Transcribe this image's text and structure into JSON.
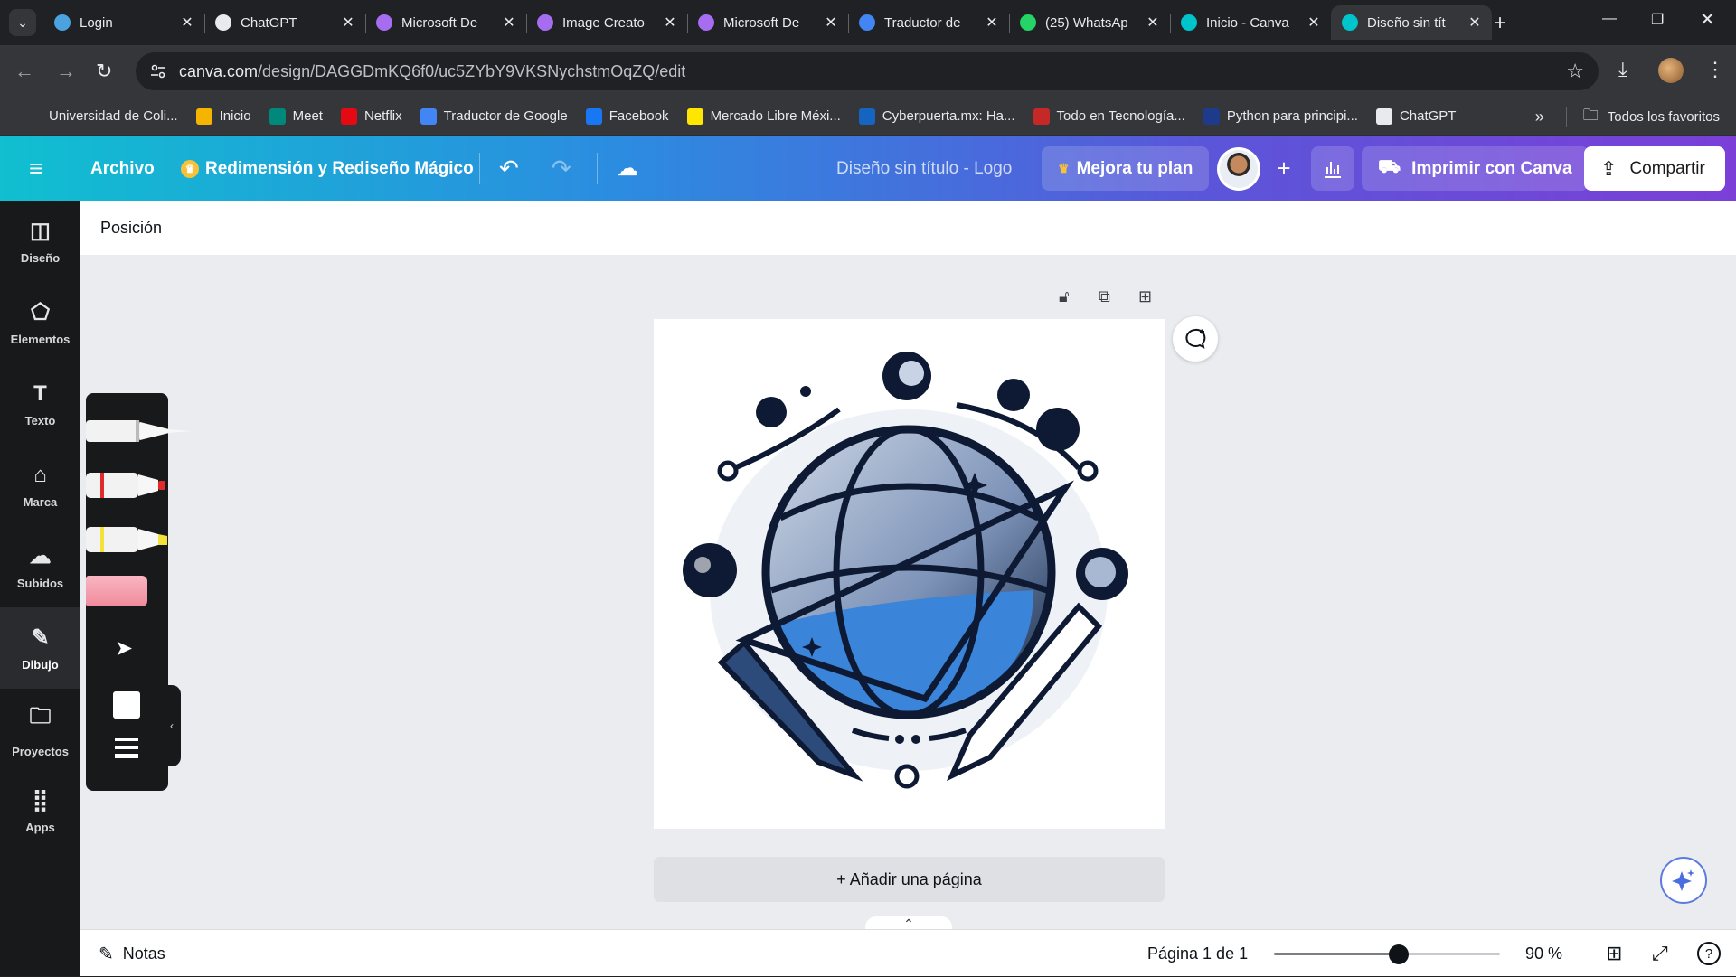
{
  "browser": {
    "tabs": [
      {
        "title": "Login",
        "icon": "login-icon",
        "color": "#4aa3df"
      },
      {
        "title": "ChatGPT",
        "icon": "chatgpt-icon",
        "color": "#e8eaed"
      },
      {
        "title": "Microsoft De",
        "icon": "microsoft-designer-icon",
        "color": "#a66df0"
      },
      {
        "title": "Image Creato",
        "icon": "image-creator-icon",
        "color": "#a66df0"
      },
      {
        "title": "Microsoft De",
        "icon": "microsoft-designer-icon",
        "color": "#a66df0"
      },
      {
        "title": "Traductor de",
        "icon": "google-translate-icon",
        "color": "#4285f4"
      },
      {
        "title": "(25) WhatsAp",
        "icon": "whatsapp-icon",
        "color": "#25d366"
      },
      {
        "title": "Inicio - Canva",
        "icon": "canva-icon",
        "color": "#00c4cc"
      },
      {
        "title": "Diseño sin tít",
        "icon": "canva-icon",
        "color": "#00c4cc",
        "active": true
      }
    ],
    "url_domain": "canva.com",
    "url_path": "/design/DAGGDmKQ6f0/uc5ZYbY9VKSNychstmOqZQ/edit",
    "bookmarks": [
      {
        "label": "Universidad de Coli...",
        "icon": "blank-icon",
        "color": "#35363a"
      },
      {
        "label": "Inicio",
        "icon": "classroom-icon",
        "color": "#f4b400"
      },
      {
        "label": "Meet",
        "icon": "meet-icon",
        "color": "#00897b"
      },
      {
        "label": "Netflix",
        "icon": "netflix-icon",
        "color": "#e50914"
      },
      {
        "label": "Traductor de Google",
        "icon": "google-translate-icon",
        "color": "#4285f4"
      },
      {
        "label": "Facebook",
        "icon": "facebook-icon",
        "color": "#1877f2"
      },
      {
        "label": "Mercado Libre Méxi...",
        "icon": "mercadolibre-icon",
        "color": "#ffe600"
      },
      {
        "label": "Cyberpuerta.mx: Ha...",
        "icon": "cyberpuerta-icon",
        "color": "#1565c0"
      },
      {
        "label": "Todo en Tecnología...",
        "icon": "todo-tecnologia-icon",
        "color": "#c62828"
      },
      {
        "label": "Python para principi...",
        "icon": "python-icon",
        "color": "#1e3a8a"
      },
      {
        "label": "ChatGPT",
        "icon": "chatgpt-icon",
        "color": "#e8eaed"
      }
    ],
    "all_bookmarks": "Todos los favoritos"
  },
  "header": {
    "file": "Archivo",
    "magic": "Redimensión y Rediseño Mágico",
    "design_title": "Diseño sin título - Logo",
    "upgrade": "Mejora tu plan",
    "print": "Imprimir con Canva",
    "share": "Compartir",
    "brand_gradient": [
      "#10bfd0",
      "#7b3fd8"
    ]
  },
  "rail": [
    {
      "label": "Diseño",
      "icon": "layout-icon"
    },
    {
      "label": "Elementos",
      "icon": "shapes-icon"
    },
    {
      "label": "Texto",
      "icon": "text-icon"
    },
    {
      "label": "Marca",
      "icon": "brand-icon"
    },
    {
      "label": "Subidos",
      "icon": "upload-cloud-icon"
    },
    {
      "label": "Dibujo",
      "icon": "draw-icon",
      "active": true
    },
    {
      "label": "Proyectos",
      "icon": "folder-icon"
    },
    {
      "label": "Apps",
      "icon": "apps-grid-icon"
    }
  ],
  "workspace": {
    "position": "Posición",
    "add_page": "+ Añadir una página"
  },
  "footer": {
    "notes": "Notas",
    "page_info": "Página 1 de 1",
    "zoom": "90 %",
    "zoom_level": 0.55
  }
}
